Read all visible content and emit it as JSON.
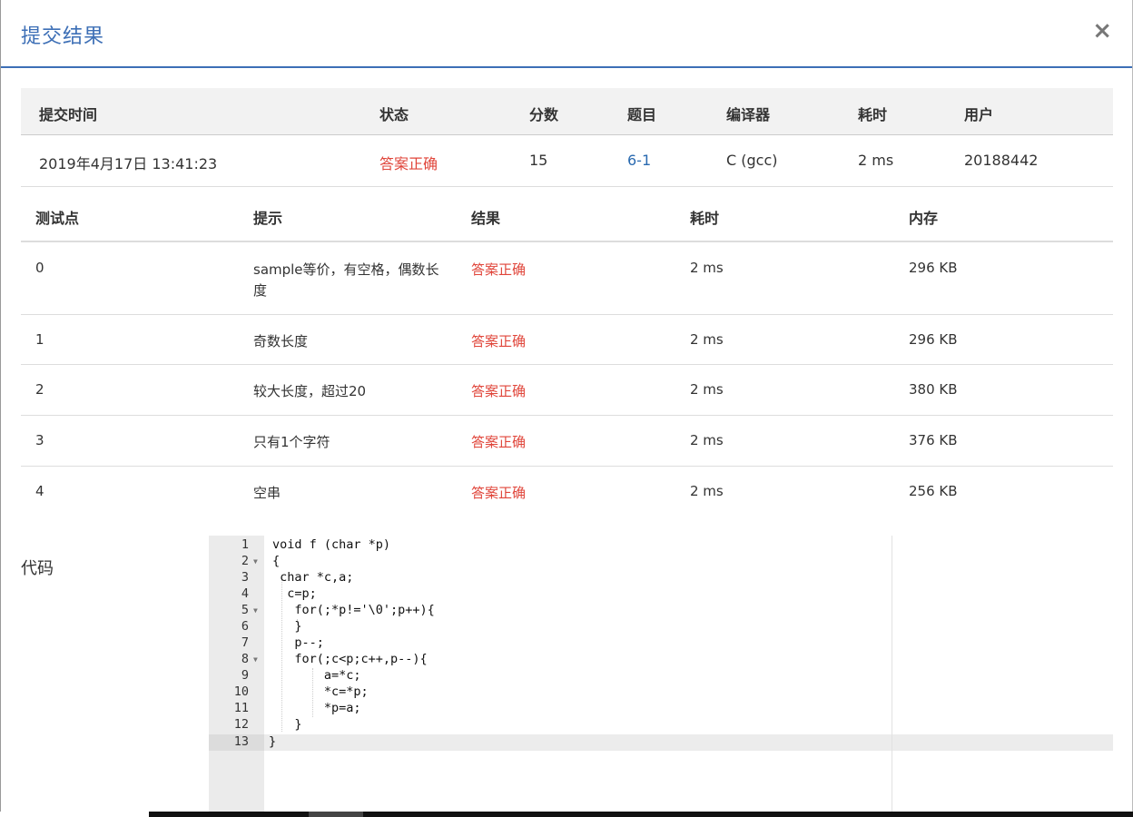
{
  "dialog": {
    "title": "提交结果",
    "close_label": "×"
  },
  "summary": {
    "headers": [
      "提交时间",
      "状态",
      "分数",
      "题目",
      "编译器",
      "耗时",
      "用户"
    ],
    "values": {
      "time": "2019年4月17日 13:41:23",
      "status": "答案正确",
      "score": "15",
      "problem": "6-1",
      "compiler": "C (gcc)",
      "elapsed": "2 ms",
      "user": "20188442"
    }
  },
  "cases": {
    "headers": [
      "测试点",
      "提示",
      "结果",
      "耗时",
      "内存"
    ],
    "rows": [
      {
        "id": "0",
        "hint": "sample等价，有空格，偶数长",
        "hint2": "度",
        "result": "答案正确",
        "time": "2 ms",
        "memory": "296 KB"
      },
      {
        "id": "1",
        "hint": "奇数长度",
        "hint2": "",
        "result": "答案正确",
        "time": "2 ms",
        "memory": "296 KB"
      },
      {
        "id": "2",
        "hint": "较大长度，超过20",
        "hint2": "",
        "result": "答案正确",
        "time": "2 ms",
        "memory": "380 KB"
      },
      {
        "id": "3",
        "hint": "只有1个字符",
        "hint2": "",
        "result": "答案正确",
        "time": "2 ms",
        "memory": "376 KB"
      },
      {
        "id": "4",
        "hint": "空串",
        "hint2": "",
        "result": "答案正确",
        "time": "2 ms",
        "memory": "256 KB"
      }
    ]
  },
  "code": {
    "label": "代码",
    "line_numbers": [
      "1",
      "2",
      "3",
      "4",
      "5",
      "6",
      "7",
      "8",
      "9",
      "10",
      "11",
      "12",
      "13"
    ],
    "lines": [
      "void f (char *p)",
      "{",
      " char *c,a;",
      "  c=p;",
      "   for(;*p!='\\0';p++){",
      "   }",
      "   p--;",
      "   for(;c<p;c++,p--){",
      "       a=*c;",
      "       *c=*p;",
      "       *p=a;",
      "   }",
      "}"
    ]
  }
}
